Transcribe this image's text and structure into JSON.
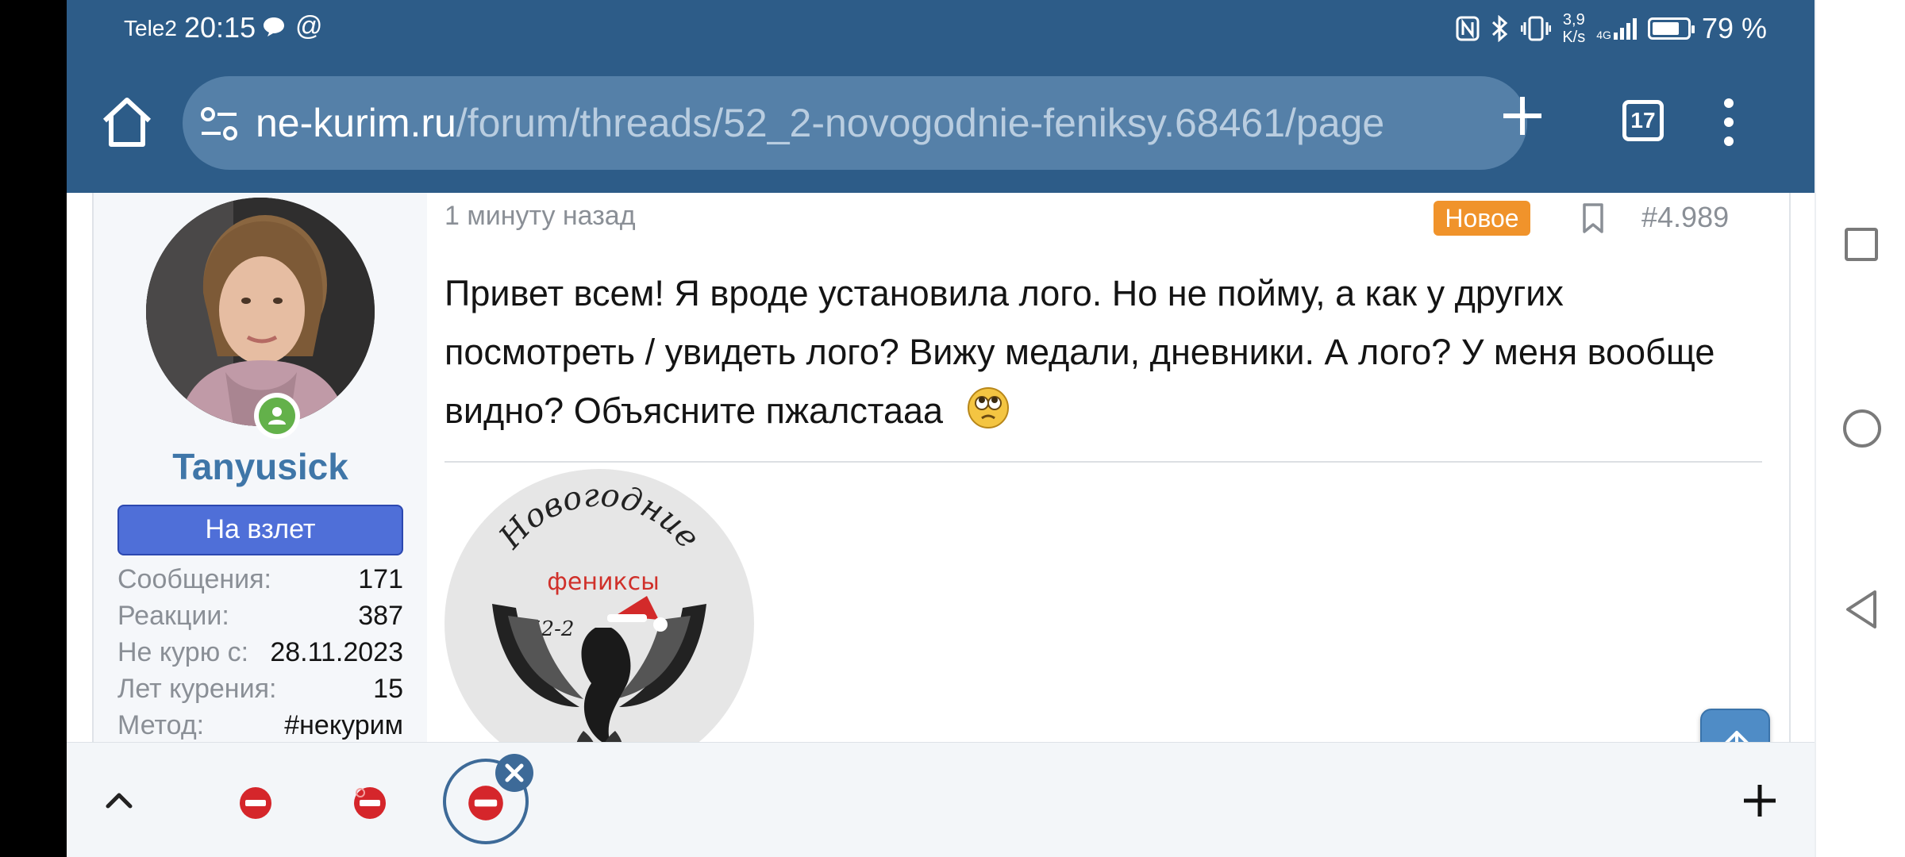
{
  "status_bar": {
    "carrier": "Tele2",
    "time": "20:15",
    "at_symbol": "@",
    "net_speed_value": "3,9",
    "net_speed_unit": "K/s",
    "network_type": "4G",
    "battery_percent_text": "79 %",
    "battery_level": 0.79,
    "icons": [
      "message-icon",
      "nfc-icon",
      "bluetooth-icon",
      "vibrate-icon",
      "signal-icon",
      "battery-icon"
    ]
  },
  "browser": {
    "url_domain": "ne-kurim.ru",
    "url_path": "/forum/threads/52_2-novogodnie-feniksy.68461/page",
    "tab_count": "17",
    "theme_color": "#2d5c88",
    "icons": [
      "home-icon",
      "tune-icon",
      "plus-icon",
      "kebab-menu-icon"
    ]
  },
  "post": {
    "author": {
      "username": "Tanyusick",
      "rank": "На взлет",
      "online": true,
      "stats": [
        {
          "label": "Сообщения:",
          "value": "171"
        },
        {
          "label": "Реакции:",
          "value": "387"
        },
        {
          "label": "Не курю с:",
          "value": "28.11.2023"
        },
        {
          "label": "Лет курения:",
          "value": "15"
        },
        {
          "label": "Метод:",
          "value": "#некурим"
        }
      ]
    },
    "time": "1 минуту назад",
    "new_badge": "Новое",
    "number": "#4.989",
    "text": "Привет всем! Я вроде установила лого. Но не пойму, а как у других посмотреть / увидеть лого? Вижу медали, дневники. А лого? У меня вообще видно? Объясните пжалстааа",
    "emoji": "pleading-emoji-icon",
    "logo": {
      "line1": "Новогодние",
      "line2": "фениксы",
      "line3": "52-2"
    },
    "accent_color": "#3f76a8",
    "badge_color": "#f0932b"
  },
  "scroll_controls": {
    "up": "arrow-up-icon",
    "down": "arrow-down-icon"
  },
  "tab_strip": {
    "tabs": [
      "no-smoking-favicon",
      "no-smoking-favicon",
      "no-smoking-favicon"
    ],
    "active_index": 2
  },
  "navigation_bar": [
    "recents-square-icon",
    "home-circle-icon",
    "back-triangle-icon"
  ]
}
